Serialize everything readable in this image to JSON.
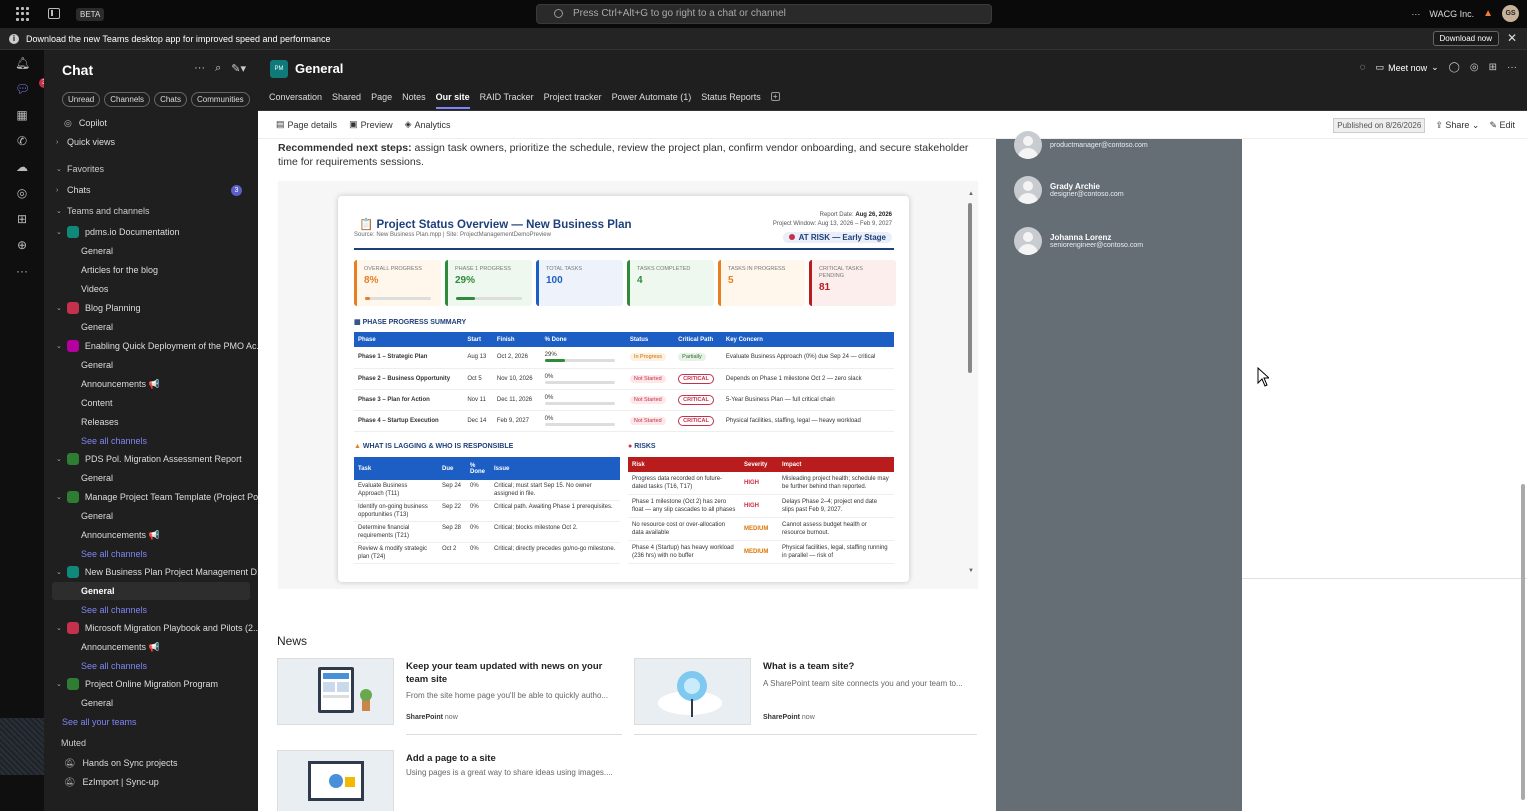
{
  "topbar": {
    "beta": "BETA",
    "search_placeholder": "Press Ctrl+Alt+G to go right to a chat or channel",
    "more": "···",
    "org": "WACG Inc.",
    "avatar": "GS"
  },
  "banner": {
    "text": "Download the new Teams desktop app for improved speed and performance",
    "button": "Download now"
  },
  "rail": {
    "chat_badge": "3"
  },
  "sidebar": {
    "title": "Chat",
    "filters": [
      "Unread",
      "Channels",
      "Chats",
      "Communities"
    ],
    "copilot": "Copilot",
    "quick_views": "Quick views",
    "favorites": "Favorites",
    "chats": "Chats",
    "chats_count": "3",
    "teams_header": "Teams and channels",
    "teams": [
      {
        "name": "pdms.io Documentation",
        "color": "#0f8a7a",
        "channels": [
          "General",
          "Articles for the blog",
          "Videos"
        ]
      },
      {
        "name": "Blog Planning",
        "color": "#c4314b",
        "channels": [
          "General"
        ]
      },
      {
        "name": "Enabling Quick Deployment of the PMO Ac...",
        "color": "#b4009e",
        "channels": [
          "General",
          "Announcements 📢",
          "Content",
          "Releases"
        ],
        "see_all": "See all channels"
      },
      {
        "name": "PDS Pol. Migration Assessment Report",
        "color": "#2e7d32",
        "channels": [
          "General"
        ]
      },
      {
        "name": "Manage Project Team Template (Project Po...",
        "color": "#2e7d32",
        "channels": [
          "General",
          "Announcements 📢"
        ],
        "see_all": "See all channels"
      },
      {
        "name": "New Business Plan Project Management D...",
        "color": "#0f8a7a",
        "channels": [
          "General"
        ],
        "see_all": "See all channels"
      },
      {
        "name": "Microsoft Migration Playbook and Pilots (2...",
        "color": "#c4314b",
        "channels": [
          "Announcements 📢"
        ],
        "see_all": "See all channels"
      },
      {
        "name": "Project Online Migration Program",
        "color": "#2e7d32",
        "channels": [
          "General"
        ]
      }
    ],
    "see_all_teams": "See all your teams",
    "muted": "Muted",
    "muted_items": [
      "Hands on Sync projects",
      "EzImport | Sync-up"
    ]
  },
  "channel": {
    "logo": "PM",
    "name": "General",
    "tabs": [
      "Conversation",
      "Shared",
      "Page",
      "Notes",
      "Our site",
      "RAID Tracker",
      "Project tracker",
      "Power Automate (1)",
      "Status Reports"
    ],
    "active_tab": "Our site",
    "meet": "Meet now"
  },
  "sp_bar": {
    "page_details": "Page details",
    "preview": "Preview",
    "analytics": "Analytics",
    "published": "Published on 8/26/2026",
    "share": "Share",
    "edit": "Edit"
  },
  "recommend": {
    "bold": "Recommended next steps:",
    "text": " assign task owners, prioritize the schedule, review the project plan, confirm vendor onboarding, and secure stakeholder time for requirements sessions."
  },
  "report": {
    "title": "📋 Project Status Overview — New Business Plan",
    "source": "Source: New Business Plan.mpp  |  Site: ProjectManagementDemoPreview",
    "report_date_label": "Report Date:",
    "report_date": "Aug 26, 2026",
    "window": "Project Window: Aug 13, 2026 – Feb 9, 2027",
    "risk_badge": "AT RISK — Early Stage",
    "kpis": [
      {
        "label": "OVERALL PROGRESS",
        "value": "8%",
        "color": "#e67e22",
        "bg": "#fff6ec",
        "progress": 0.08
      },
      {
        "label": "PHASE 1 PROGRESS",
        "value": "29%",
        "color": "#2e8b3a",
        "bg": "#eef8ee",
        "progress": 0.29
      },
      {
        "label": "TOTAL TASKS",
        "value": "100",
        "color": "#1d5ec4",
        "bg": "#eef3fb"
      },
      {
        "label": "TASKS COMPLETED",
        "value": "4",
        "color": "#2e8b3a",
        "bg": "#eef8ee"
      },
      {
        "label": "TASKS IN PROGRESS",
        "value": "5",
        "color": "#e67e22",
        "bg": "#fff6ec"
      },
      {
        "label": "CRITICAL TASKS PENDING",
        "value": "81",
        "color": "#b91c1c",
        "bg": "#fdeeee"
      }
    ],
    "phase_section": "PHASE PROGRESS SUMMARY",
    "phase_headers": [
      "Phase",
      "Start",
      "Finish",
      "% Done",
      "Status",
      "Critical Path",
      "Key Concern"
    ],
    "phases": [
      {
        "phase": "Phase 1 – Strategic Plan",
        "start": "Aug 13",
        "finish": "Oct 2, 2026",
        "done": "29%",
        "done_frac": 0.29,
        "status": "In Progress",
        "critical": "Partially",
        "concern": "Evaluate Business Approach (0%) due Sep 24 — critical"
      },
      {
        "phase": "Phase 2 – Business Opportunity",
        "start": "Oct 5",
        "finish": "Nov 10, 2026",
        "done": "0%",
        "done_frac": 0,
        "status": "Not Started",
        "critical": "CRITICAL",
        "concern": "Depends on Phase 1 milestone Oct 2 — zero slack"
      },
      {
        "phase": "Phase 3 – Plan for Action",
        "start": "Nov 11",
        "finish": "Dec 11, 2026",
        "done": "0%",
        "done_frac": 0,
        "status": "Not Started",
        "critical": "CRITICAL",
        "concern": "5-Year Business Plan — full critical chain"
      },
      {
        "phase": "Phase 4 – Startup Execution",
        "start": "Dec 14",
        "finish": "Feb 9, 2027",
        "done": "0%",
        "done_frac": 0,
        "status": "Not Started",
        "critical": "CRITICAL",
        "concern": "Physical facilities, staffing, legal — heavy workload"
      }
    ],
    "lag_section": "WHAT IS LAGGING & WHO IS RESPONSIBLE",
    "lag_headers": [
      "Task",
      "Due",
      "% Done",
      "Issue"
    ],
    "lag_rows": [
      {
        "task": "Evaluate Business Approach (T11)",
        "due": "Sep 24",
        "done": "0%",
        "issue": "Critical; must start Sep 15. No owner assigned in file."
      },
      {
        "task": "Identify on-going business opportunities (T13)",
        "due": "Sep 22",
        "done": "0%",
        "issue": "Critical path. Awaiting Phase 1 prerequisites."
      },
      {
        "task": "Determine financial requirements (T21)",
        "due": "Sep 28",
        "done": "0%",
        "issue": "Critical; blocks milestone Oct 2."
      },
      {
        "task": "Review & modify strategic plan (T24)",
        "due": "Oct 2",
        "done": "0%",
        "issue": "Critical; directly precedes go/no-go milestone."
      }
    ],
    "risk_section": "RISKS",
    "risk_headers": [
      "Risk",
      "Severity",
      "Impact"
    ],
    "risk_rows": [
      {
        "risk": "Progress data recorded on future-dated tasks (T16, T17)",
        "severity": "HIGH",
        "impact": "Misleading project health; schedule may be further behind than reported."
      },
      {
        "risk": "Phase 1 milestone (Oct 2) has zero float — any slip cascades to all phases",
        "severity": "HIGH",
        "impact": "Delays Phase 2–4; project end date slips past Feb 9, 2027."
      },
      {
        "risk": "No resource cost or over-allocation data available",
        "severity": "MEDIUM",
        "impact": "Cannot assess budget health or resource burnout."
      },
      {
        "risk": "Phase 4 (Startup) has heavy workload (236 hrs) with no buffer",
        "severity": "MEDIUM",
        "impact": "Physical facilities, legal, staffing running in parallel — risk of"
      }
    ]
  },
  "news": {
    "title": "News",
    "items": [
      {
        "title": "Keep your team updated with news on your team site",
        "desc": "From the site home page you'll be able to quickly autho...",
        "source": "SharePoint",
        "time": "now"
      },
      {
        "title": "What is a team site?",
        "desc": "A SharePoint team site connects you and your team to...",
        "source": "SharePoint",
        "time": "now"
      },
      {
        "title": "Add a page to a site",
        "desc": "Using pages is a great way to share ideas using images...."
      }
    ]
  },
  "people": [
    {
      "name": "",
      "email": "productmanager@contoso.com"
    },
    {
      "name": "Grady Archie",
      "email": "designer@contoso.com"
    },
    {
      "name": "Johanna Lorenz",
      "email": "seniorengineer@contoso.com"
    }
  ]
}
